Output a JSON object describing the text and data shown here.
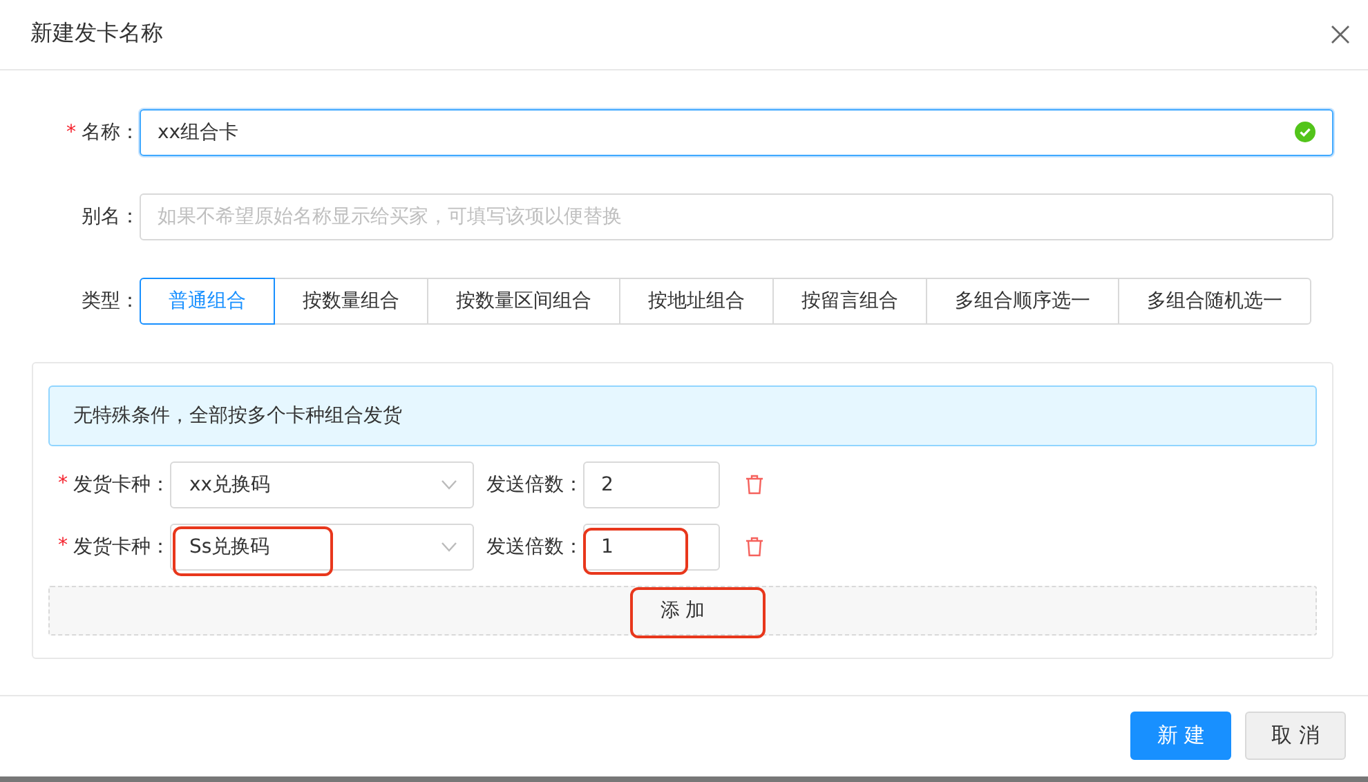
{
  "dialog": {
    "title": "新建发卡名称"
  },
  "name_field": {
    "label": "名称：",
    "required_mark": "*",
    "value": "xx组合卡",
    "valid": true
  },
  "alias_field": {
    "label": "别名：",
    "placeholder": "如果不希望原始名称显示给买家，可填写该项以便替换"
  },
  "type_field": {
    "label": "类型：",
    "options": [
      {
        "label": "普通组合",
        "selected": true
      },
      {
        "label": "按数量组合",
        "selected": false
      },
      {
        "label": "按数量区间组合",
        "selected": false
      },
      {
        "label": "按地址组合",
        "selected": false
      },
      {
        "label": "按留言组合",
        "selected": false
      },
      {
        "label": "多组合顺序选一",
        "selected": false
      },
      {
        "label": "多组合随机选一",
        "selected": false
      }
    ]
  },
  "info_message": "无特殊条件，全部按多个卡种组合发货",
  "card_rows": [
    {
      "card_label": "发货卡种：",
      "required_mark": "*",
      "card_value": "xx兑换码",
      "card_highlighted": false,
      "multiplier_label": "发送倍数：",
      "multiplier_value": "2",
      "multiplier_highlighted": false
    },
    {
      "card_label": "发货卡种：",
      "required_mark": "*",
      "card_value": "Ss兑换码",
      "card_highlighted": true,
      "multiplier_label": "发送倍数：",
      "multiplier_value": "1",
      "multiplier_highlighted": true
    }
  ],
  "add_button": {
    "label": "添 加",
    "highlighted": true
  },
  "footer_buttons": [
    {
      "label": "新 建",
      "kind": "primary"
    },
    {
      "label": "取 消",
      "kind": "default"
    }
  ]
}
